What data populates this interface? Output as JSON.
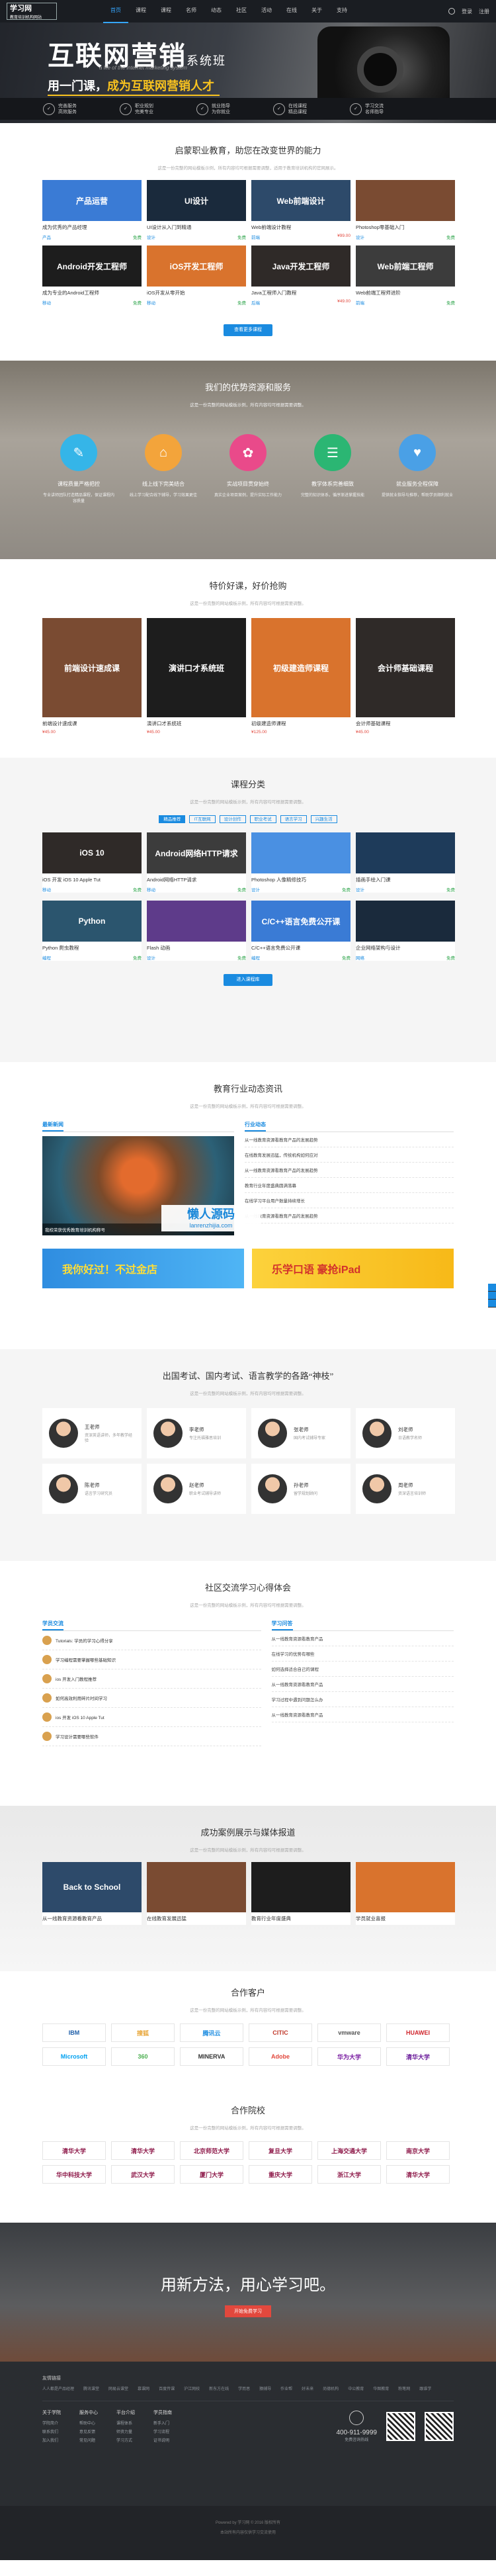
{
  "header": {
    "logo_main": "学习网",
    "logo_sub": "教育培训机构网站",
    "nav": [
      "首页",
      "课程",
      "课程",
      "名师",
      "动态",
      "社区",
      "活动",
      "在线",
      "关于",
      "支持"
    ],
    "login": "登录",
    "register": "注册"
  },
  "banner": {
    "title": "互联网营销",
    "title_small": "系统班",
    "en": "a lite of the internet marketing system",
    "sub_pre": "用一门课，",
    "sub_em": "成为互联网营销人才"
  },
  "features": [
    {
      "t": "完善服务",
      "d": "高效服务"
    },
    {
      "t": "职业规划",
      "d": "完美专业"
    },
    {
      "t": "就业指导",
      "d": "为你就业"
    },
    {
      "t": "在线课程",
      "d": "精品课程"
    },
    {
      "t": "学习交流",
      "d": "名师指导"
    }
  ],
  "sec1": {
    "title": "启蒙职业教育，助您在改变世界的能力",
    "desc": "这是一份完整的网站模板示例，所有内容均可根据需要调整，适用于教育培训机构的官网展示。",
    "cards": [
      {
        "thumb": "产品运营",
        "name": "成为优秀的产品经理",
        "tag": "产品",
        "free": "免费",
        "price": ""
      },
      {
        "thumb": "UI设计",
        "name": "UI设计从入门到精通",
        "tag": "设计",
        "free": "免费",
        "price": ""
      },
      {
        "thumb": "Web前端设计",
        "name": "Web前端设计教程",
        "tag": "前端",
        "free": "",
        "price": "¥99.00"
      },
      {
        "thumb": "",
        "name": "Photoshop零基础入门",
        "tag": "设计",
        "free": "免费",
        "price": ""
      },
      {
        "thumb": "Android开发工程师",
        "name": "成为专业的Android工程师",
        "tag": "移动",
        "free": "免费",
        "price": ""
      },
      {
        "thumb": "iOS开发工程师",
        "name": "iOS开发从零开始",
        "tag": "移动",
        "free": "免费",
        "price": ""
      },
      {
        "thumb": "Java开发工程师",
        "name": "Java工程师入门教程",
        "tag": "后端",
        "free": "",
        "price": "¥49.00"
      },
      {
        "thumb": "Web前端工程师",
        "name": "Web前端工程师进阶",
        "tag": "前端",
        "free": "免费",
        "price": ""
      }
    ],
    "more": "查看更多课程"
  },
  "sec2": {
    "title": "我们的优势资源和服务",
    "desc": "这是一份完整的网站模板示例，所有内容均可根据需要调整。",
    "items": [
      {
        "t": "课程质量严格把控",
        "d": "专业讲师团队打造精品课程，保证课程内容质量"
      },
      {
        "t": "线上线下完美结合",
        "d": "线上学习配合线下辅导，学习效果更佳"
      },
      {
        "t": "实战项目贯穿始终",
        "d": "真实企业项目案例，提升实际工作能力"
      },
      {
        "t": "教学体系完善细致",
        "d": "完整的知识体系，循序渐进掌握技能"
      },
      {
        "t": "就业服务全程保障",
        "d": "提供就业指导与推荐，帮助学员顺利就业"
      }
    ]
  },
  "sec3": {
    "title": "特价好课，好价抢购",
    "desc": "这是一份完整的网站模板示例，所有内容均可根据需要调整。",
    "cards": [
      {
        "thumb": "前端设计速成课",
        "name": "前端设计速成课",
        "price": "¥45.00"
      },
      {
        "thumb": "演讲口才系统班",
        "name": "演讲口才系统班",
        "price": "¥45.00"
      },
      {
        "thumb": "初级建造师课程",
        "name": "初级建造师课程",
        "price": "¥125.00"
      },
      {
        "thumb": "会计师基础课程",
        "name": "会计师基础课程",
        "price": "¥45.00"
      }
    ]
  },
  "sec4": {
    "title": "课程分类",
    "desc": "这是一份完整的网站模板示例，所有内容均可根据需要调整。",
    "tabs": [
      "精品推荐",
      "IT互联网",
      "设计创作",
      "职业考试",
      "语言学习",
      "兴趣生活"
    ],
    "cards": [
      {
        "thumb": "iOS 10",
        "name": "iOS 开发 iOS 10 Apple Tut",
        "tag": "移动",
        "free": "免费"
      },
      {
        "thumb": "Android网络HTTP请求",
        "name": "Android网络HTTP请求",
        "tag": "移动",
        "free": "免费"
      },
      {
        "thumb": "",
        "name": "Photoshop 人像精修技巧",
        "tag": "设计",
        "free": "免费"
      },
      {
        "thumb": "",
        "name": "插画手绘入门课",
        "tag": "设计",
        "free": "免费"
      },
      {
        "thumb": "Python",
        "name": "Python 爬虫教程",
        "tag": "编程",
        "free": "免费"
      },
      {
        "thumb": "",
        "name": "Flash 动画",
        "tag": "设计",
        "free": "免费"
      },
      {
        "thumb": "C/C++语言免费公开课",
        "name": "C/C++语言免费公开课",
        "tag": "编程",
        "free": "免费"
      },
      {
        "thumb": "",
        "name": "企业网络架构与设计",
        "tag": "网络",
        "free": "免费"
      }
    ],
    "more": "进入课程库"
  },
  "sec5": {
    "title": "教育行业动态资讯",
    "desc": "这是一份完整的网站模板示例，所有内容均可根据需要调整。",
    "left_head": "最新新闻",
    "left_caption": "我校荣获优秀教育培训机构称号",
    "right_head": "行业动态",
    "news": [
      "从一线教育资源看教育产品的发展趋势",
      "在线教育发展迅猛，传统机构如何应对",
      "从一线教育资源看教育产品的发展趋势",
      "教育行业年度盛典圆满落幕",
      "在线学习平台用户数量持续增长",
      "从一线教育资源看教育产品的发展趋势"
    ],
    "watermark": "懒人源码",
    "watermark_url": "lanrenzhijia.com",
    "ad1": "我你好过！不过金店",
    "ad2": "乐学口语 豪抢iPad"
  },
  "sec6": {
    "title": "出国考试、国内考试、语言教学的各路“神枝”",
    "desc": "这是一份完整的网站模板示例，所有内容均可根据需要调整。",
    "teachers": [
      {
        "n": "王老师",
        "t": "资深英语讲师，多年教学经验"
      },
      {
        "n": "李老师",
        "t": "专注托福雅思培训"
      },
      {
        "n": "张老师",
        "t": "国内考试辅导专家"
      },
      {
        "n": "刘老师",
        "t": "日语教学名师"
      },
      {
        "n": "陈老师",
        "t": "语言学习研究员"
      },
      {
        "n": "赵老师",
        "t": "职业考试辅导讲师"
      },
      {
        "n": "孙老师",
        "t": "留学规划顾问"
      },
      {
        "n": "周老师",
        "t": "资深语言培训师"
      }
    ]
  },
  "sec7": {
    "title": "社区交流学习心得体会",
    "desc": "这是一份完整的网站模板示例，所有内容均可根据需要调整。",
    "left_head": "学员交流",
    "right_head": "学习问答",
    "posts": [
      "Tutorials: 学员的学习心得分享",
      "学习编程需要掌握哪些基础知识",
      "ios 开发入门教程推荐",
      "如何高效利用碎片时间学习",
      "ios 开发 iOS 10 Apple Tut",
      "学习设计需要哪些软件"
    ],
    "qa": [
      "从一线教育资源看教育产品",
      "在线学习的优势有哪些",
      "如何选择适合自己的课程",
      "从一线教育资源看教育产品",
      "学习过程中遇到问题怎么办",
      "从一线教育资源看教育产品"
    ]
  },
  "sec8": {
    "title": "成功案例展示与媒体报道",
    "desc": "这是一份完整的网站模板示例，所有内容均可根据需要调整。",
    "cases": [
      {
        "thumb": "Back to School",
        "name": "从一线教育资源看教育产品"
      },
      {
        "thumb": "",
        "name": "在线教育发展迅猛"
      },
      {
        "thumb": "",
        "name": "教育行业年度盛典"
      },
      {
        "thumb": "",
        "name": "学员就业喜报"
      }
    ]
  },
  "sec9": {
    "title": "合作客户",
    "desc": "这是一份完整的网站模板示例，所有内容均可根据需要调整。",
    "logos": [
      "IBM",
      "搜狐",
      "腾讯云",
      "CITIC",
      "vmware",
      "HUAWEI",
      "Microsoft",
      "360",
      "MINERVA",
      "Adobe",
      "华为大学",
      "清华大学"
    ]
  },
  "sec10": {
    "title": "合作院校",
    "desc": "这是一份完整的网站模板示例，所有内容均可根据需要调整。",
    "logos": [
      "清华大学",
      "清华大学",
      "北京师范大学",
      "复旦大学",
      "上海交通大学",
      "南京大学",
      "华中科技大学",
      "武汉大学",
      "厦门大学",
      "重庆大学",
      "浙江大学",
      "清华大学"
    ]
  },
  "cta": {
    "line": "用新方法，用心学习吧。",
    "btn": "开始免费学习"
  },
  "footer": {
    "links_head": "友情链接",
    "links": [
      "人人都是产品经理",
      "腾讯课堂",
      "网易云课堂",
      "慕课网",
      "百度传课",
      "沪江网校",
      "新东方在线",
      "学而思",
      "猿辅导",
      "作业帮",
      "好未来",
      "尚德机构",
      "中公教育",
      "华图教育",
      "粉笔网",
      "跟谁学"
    ],
    "cols": [
      {
        "h": "关于学院",
        "items": [
          "学院简介",
          "联系我们",
          "加入我们"
        ]
      },
      {
        "h": "服务中心",
        "items": [
          "帮助中心",
          "意见反馈",
          "常见问题"
        ]
      },
      {
        "h": "平台介绍",
        "items": [
          "课程体系",
          "师资力量",
          "学习方式"
        ]
      },
      {
        "h": "学员指南",
        "items": [
          "新手入门",
          "学习流程",
          "证书说明"
        ]
      }
    ],
    "phone": "400-911-9999",
    "phone_label": "免费咨询热线",
    "copy1": "Powered by 学习网 © 2016 版权所有",
    "copy2": "本站所有内容仅供学习交流使用"
  },
  "colors": {
    "accent": "#1a8be0",
    "dark": "#1a1d22",
    "yellow": "#f9c31f",
    "red": "#e2483d"
  }
}
